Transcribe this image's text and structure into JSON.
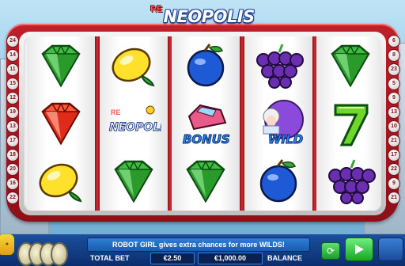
{
  "game": {
    "logo_prefix": "RE",
    "logo_title": "NEOPOLIS"
  },
  "paylines": {
    "left": [
      "24",
      "14",
      "11",
      "15",
      "12",
      "19",
      "13",
      "17",
      "18",
      "20",
      "16",
      "22"
    ],
    "right": [
      "6",
      "8",
      "23",
      "5",
      "9",
      "13",
      "10",
      "21",
      "17",
      "22",
      "9",
      "21"
    ]
  },
  "reels": [
    [
      "diamond-green-icon",
      "diamond-red-icon",
      "lemon-icon"
    ],
    [
      "lemon-icon",
      "neopolis-logo-icon",
      "diamond-green-icon"
    ],
    [
      "plum-icon",
      "bonus-car-icon",
      "diamond-green-icon"
    ],
    [
      "grapes-icon",
      "robot-girl-wild-icon",
      "plum-icon"
    ],
    [
      "diamond-green-icon",
      "seven-icon",
      "grapes-icon"
    ]
  ],
  "symbol_labels": {
    "bonus": "BONUS",
    "wild": "WILD",
    "neopolis": "NEOPOLIS",
    "neopolis_re": "RE"
  },
  "panel": {
    "message": "ROBOT GIRL gives extra chances for more WILDS!",
    "total_bet_label": "TOTAL BET",
    "total_bet_value": "€2.50",
    "balance_value": "€1,000.00",
    "balance_label": "BALANCE"
  },
  "colors": {
    "frame": "#c0202a",
    "panel": "#1b4f9e",
    "spin": "#18a528"
  }
}
